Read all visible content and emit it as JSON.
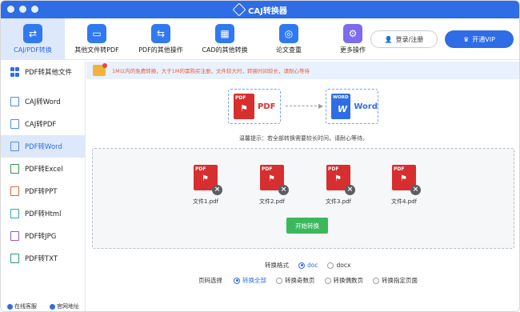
{
  "app": {
    "title": "CAJ转换器"
  },
  "toolbar": {
    "tools": [
      {
        "label": "CAJ/PDF转换",
        "icon": "file-convert-icon"
      },
      {
        "label": "其他文件转PDF",
        "icon": "folder-icon"
      },
      {
        "label": "PDF的其他操作",
        "icon": "swap-icon"
      },
      {
        "label": "CAD的其他转换",
        "icon": "cad-icon"
      },
      {
        "label": "论文查重",
        "icon": "search-doc-icon"
      },
      {
        "label": "更多操作",
        "icon": "gear-icon"
      }
    ],
    "login": "登录/注册",
    "vip": "开通VIP"
  },
  "sidebar": {
    "items": [
      {
        "label": "PDF转其他文件"
      },
      {
        "label": "CAJ转Word"
      },
      {
        "label": "CAJ转PDF"
      },
      {
        "label": "PDF转Word"
      },
      {
        "label": "PDF转Excel"
      },
      {
        "label": "PDF转PPT"
      },
      {
        "label": "PDF转Html"
      },
      {
        "label": "PDF转JPG"
      },
      {
        "label": "PDF转TXT"
      }
    ],
    "footer": {
      "service": "在线客服",
      "website": "官网地址"
    }
  },
  "notice": {
    "text": "1M以内的免费转换，大于1M的需购买注册，文件较大时，转换时间较长，请耐心等待"
  },
  "conversion": {
    "from_badge": "PDF",
    "from_label": "PDF",
    "to_badge": "WORD",
    "to_label": "Word"
  },
  "tip": "温馨提示：若全部转换需要较长时间，请耐心等待。",
  "files": [
    {
      "name": "文件1.pdf",
      "badge": "PDF"
    },
    {
      "name": "文件2.pdf",
      "badge": "PDF"
    },
    {
      "name": "文件3.pdf",
      "badge": "PDF"
    },
    {
      "name": "文件4.pdf",
      "badge": "PDF"
    }
  ],
  "start_button": "开始转换",
  "format": {
    "label": "转换格式",
    "options": [
      "doc",
      "docx"
    ],
    "selected": "doc"
  },
  "pages": {
    "label": "页码选择",
    "options": [
      "转换全部",
      "转换奇数页",
      "转换偶数页",
      "转换指定页面"
    ],
    "selected": "转换全部"
  },
  "colors": {
    "accent": "#2f6de6",
    "pdf": "#d72f2f",
    "start": "#3cb85c",
    "notice": "#e65c3c"
  }
}
